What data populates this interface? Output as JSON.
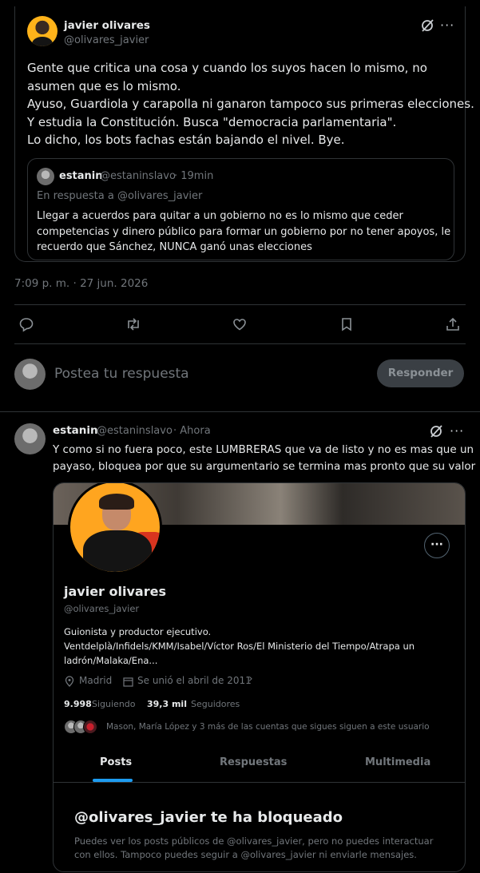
{
  "main_tweet": {
    "author_name": "javier olivares",
    "author_handle": "@olivares_javier",
    "lines": [
      "Gente que critica una cosa y cuando los suyos hacen lo mismo, no",
      "asumen que es lo mismo.",
      "Ayuso, Guardiola y carapolla ni ganaron tampoco sus primeras elecciones.",
      "Y estudia la Constitución. Busca \"democracia parlamentaria\".",
      "Lo dicho, los bots fachas están bajando el nivel. Bye."
    ],
    "quote": {
      "author_name": "estanin",
      "author_handle": "@estaninslavo",
      "time": "· 19min",
      "reply_to": "En respuesta a @olivares_javier",
      "lines": [
        "Llegar a acuerdos para quitar a un gobierno no es lo mismo que ceder",
        "competencias y dinero público para formar un gobierno por no tener apoyos, le",
        "recuerdo que Sánchez, NUNCA ganó unas elecciones"
      ]
    },
    "timestamp": "7:09 p. m. · 27 jun. 2026"
  },
  "reply_box": {
    "placeholder": "Postea tu respuesta",
    "button_label": "Responder"
  },
  "reply_tweet": {
    "author_name": "estanin",
    "author_handle": "@estaninslavo",
    "time": "· Ahora",
    "lines": [
      "Y como si no fuera poco, este LUMBRERAS que va de listo y no es mas que un",
      "payaso, bloquea por que su argumentario se termina mas pronto que su valor"
    ]
  },
  "profile": {
    "name": "javier olivares",
    "handle": "@olivares_javier",
    "bio_lines": [
      "Guionista y productor ejecutivo.",
      "Ventdelplà/Infidels/KMM/Isabel/Víctor Ros/El Ministerio del Tiempo/Atrapa un",
      "ladrón/Malaka/Ena..."
    ],
    "location": "Madrid",
    "joined": "Se unió el abril de 2011",
    "following_count": "9.998",
    "following_label": "Siguiendo",
    "followers_count": "39,3 mil",
    "followers_label": "Seguidores",
    "followed_by": "Mason, María López y 3 más de las cuentas que sigues siguen a este usuario",
    "tabs": [
      "Posts",
      "Respuestas",
      "Multimedia"
    ],
    "blocked_title": "@olivares_javier te ha bloqueado",
    "blocked_lines": [
      "Puedes ver los posts públicos de @olivares_javier, pero no puedes interactuar",
      "con ellos. Tampoco puedes seguir a @olivares_javier ni enviarle mensajes."
    ]
  },
  "icons": {
    "grok": "grok-icon",
    "more": "more-icon",
    "reply": "reply-icon",
    "retweet": "retweet-icon",
    "like": "like-icon",
    "bookmark": "bookmark-icon",
    "share": "share-icon"
  },
  "colors": {
    "accent": "#1d9bf0",
    "background": "#000000",
    "border": "#2f3336",
    "muted": "#71767b"
  }
}
